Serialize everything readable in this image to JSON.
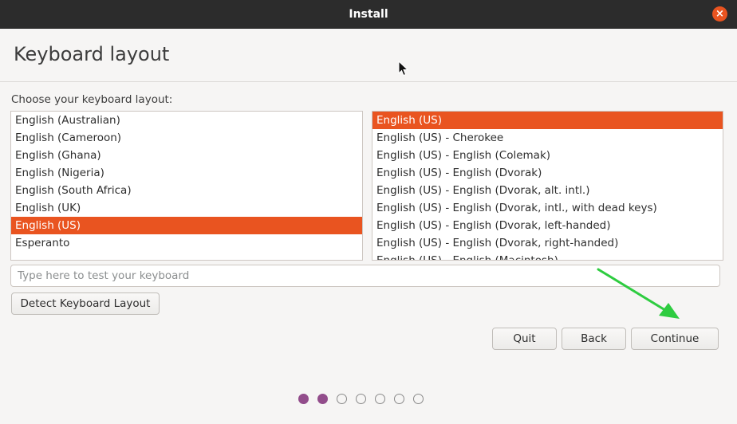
{
  "window": {
    "title": "Install",
    "close_glyph": "×"
  },
  "page": {
    "title": "Keyboard layout",
    "prompt": "Choose your keyboard layout:"
  },
  "layouts": {
    "items": [
      "English (Australian)",
      "English (Cameroon)",
      "English (Ghana)",
      "English (Nigeria)",
      "English (South Africa)",
      "English (UK)",
      "English (US)",
      "Esperanto"
    ],
    "selected": "English (US)"
  },
  "variants": {
    "items": [
      "English (US)",
      "English (US) - Cherokee",
      "English (US) - English (Colemak)",
      "English (US) - English (Dvorak)",
      "English (US) - English (Dvorak, alt. intl.)",
      "English (US) - English (Dvorak, intl., with dead keys)",
      "English (US) - English (Dvorak, left-handed)",
      "English (US) - English (Dvorak, right-handed)",
      "English (US) - English (Macintosh)"
    ],
    "selected": "English (US)"
  },
  "test_input": {
    "placeholder": "Type here to test your keyboard",
    "value": ""
  },
  "buttons": {
    "detect": "Detect Keyboard Layout",
    "quit": "Quit",
    "back": "Back",
    "continue": "Continue"
  },
  "progress": {
    "total_steps": 7,
    "current_step": 2
  },
  "colors": {
    "accent": "#e95420",
    "progress_active": "#924d8b",
    "annotation_arrow": "#2ecc40"
  },
  "icons": {
    "close": "close-icon",
    "cursor": "mouse-pointer-icon",
    "annotation": "green-arrow-icon"
  }
}
